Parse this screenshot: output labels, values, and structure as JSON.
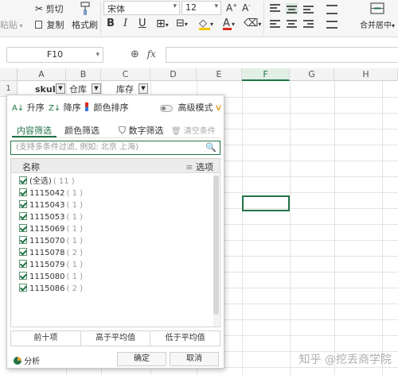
{
  "ribbon": {
    "paste": "粘贴",
    "cut": "剪切",
    "copy": "复制",
    "format_painter": "格式刷",
    "font_name": "宋体",
    "font_size": "12",
    "bold": "B",
    "italic": "I",
    "underline": "U",
    "font_color_glyph": "A",
    "merge_center": "合并居中"
  },
  "formula_bar": {
    "name_box": "F10",
    "fx": "fx",
    "value": ""
  },
  "grid": {
    "columns": [
      "A",
      "B",
      "C",
      "D",
      "E",
      "F",
      "G",
      "H"
    ],
    "selected_column": "F",
    "rows": [
      "1"
    ],
    "header_cells": {
      "a1": "skuId",
      "b1": "仓库",
      "c1": "库存"
    },
    "active_cell": "F10"
  },
  "filter_popup": {
    "sort_asc": "升序",
    "sort_desc": "降序",
    "sort_color": "颜色排序",
    "advanced_mode": "高级模式",
    "advanced_badge": "V",
    "tab_content": "内容筛选",
    "tab_color": "颜色筛选",
    "number_filter": "数字筛选",
    "clear_condition": "清空条件",
    "search_placeholder": "(支持多条件过滤, 例如: 北京 上海)",
    "list_header_name": "名称",
    "list_header_options": "选项",
    "items": [
      {
        "label": "(全选)",
        "count": "( 11 )"
      },
      {
        "label": "1115042",
        "count": "( 1 )"
      },
      {
        "label": "1115043",
        "count": "( 1 )"
      },
      {
        "label": "1115053",
        "count": "( 1 )"
      },
      {
        "label": "1115069",
        "count": "( 1 )"
      },
      {
        "label": "1115070",
        "count": "( 1 )"
      },
      {
        "label": "1115078",
        "count": "( 2 )"
      },
      {
        "label": "1115079",
        "count": "( 1 )"
      },
      {
        "label": "1115080",
        "count": "( 1 )"
      },
      {
        "label": "1115086",
        "count": "( 2 )"
      }
    ],
    "top_ten": "前十项",
    "above_average": "高于平均值",
    "below_average": "低于平均值",
    "analysis": "分析",
    "ok": "确定",
    "cancel": "取消"
  },
  "watermark": "知乎 @挖丢商学院",
  "colors": {
    "accent_green": "#217346",
    "advanced_badge": "#e8a33a",
    "font_color_red": "#e0281b",
    "fill_yellow": "#f5c500"
  }
}
